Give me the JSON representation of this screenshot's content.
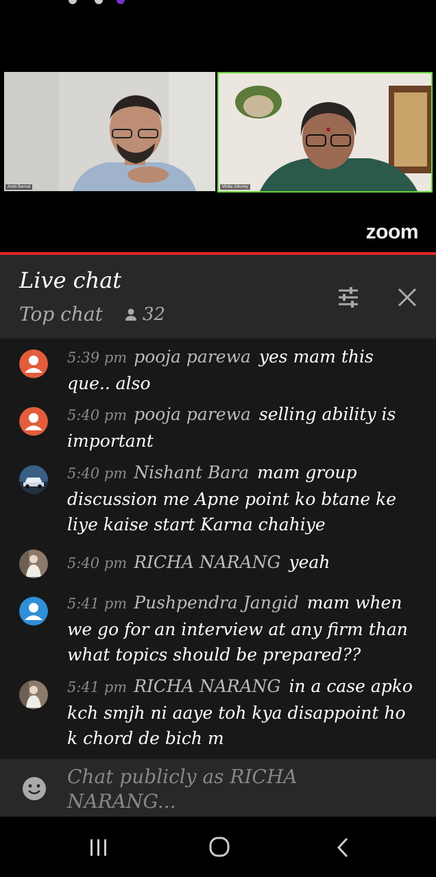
{
  "video": {
    "participants": [
      {
        "name": "Ankit Bansal"
      },
      {
        "name": "Vinita Johorey"
      }
    ],
    "logo": "zoom"
  },
  "chat": {
    "title": "Live chat",
    "mode": "Top chat",
    "viewer_count": "32",
    "messages": [
      {
        "time": "5:39 pm",
        "author": "pooja parewa",
        "text": "yes mam this que.. also",
        "avatar": "orange-default-avatar"
      },
      {
        "time": "5:40 pm",
        "author": "pooja parewa",
        "text": "selling ability is important",
        "avatar": "orange-default-avatar"
      },
      {
        "time": "5:40 pm",
        "author": "Nishant Bara",
        "text": "mam group discussion me Apne point ko btane ke liye kaise start Karna chahiye",
        "avatar": "car-photo-avatar"
      },
      {
        "time": "5:40 pm",
        "author": "RICHA NARANG",
        "text": "yeah",
        "avatar": "photo-avatar"
      },
      {
        "time": "5:41 pm",
        "author": "Pushpendra Jangid",
        "text": "mam when we go for an interview at any firm than what topics should be prepared??",
        "avatar": "blue-default-avatar"
      },
      {
        "time": "5:41 pm",
        "author": "RICHA NARANG",
        "text": "in a case apko kch smjh ni aaye toh kya disappoint ho k chord de bich m",
        "avatar": "photo-avatar"
      }
    ],
    "input_placeholder": "Chat publicly as RICHA NARANG..."
  },
  "colors": {
    "accent_red": "#e02727",
    "active_speaker_border": "#6bd13b",
    "header_bg": "#282828",
    "list_bg": "#181818"
  }
}
